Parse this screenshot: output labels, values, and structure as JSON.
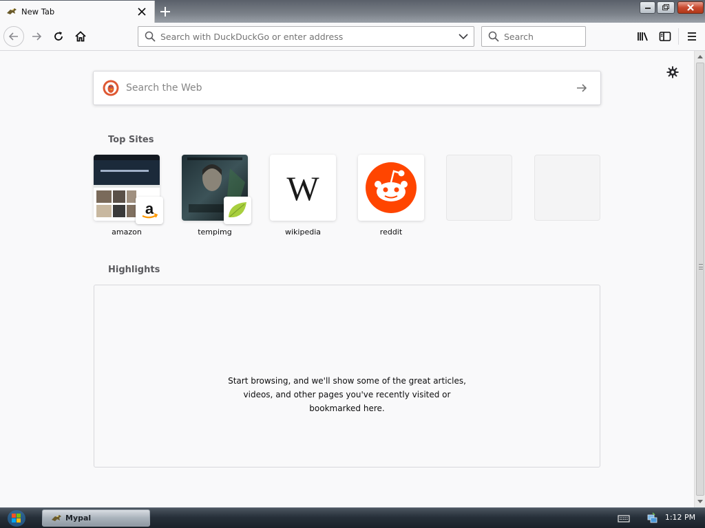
{
  "tab": {
    "title": "New Tab"
  },
  "navbar": {
    "url_placeholder": "Search with DuckDuckGo or enter address",
    "search_placeholder": "Search"
  },
  "newtab": {
    "websearch_placeholder": "Search the Web",
    "top_sites_title": "Top Sites",
    "highlights_title": "Highlights",
    "top_sites": [
      {
        "label": "amazon",
        "icon": "amazon-thumbnail"
      },
      {
        "label": "tempimg",
        "icon": "tempimg-thumbnail"
      },
      {
        "label": "wikipedia",
        "icon": "wikipedia-logo"
      },
      {
        "label": "reddit",
        "icon": "reddit-logo"
      },
      {
        "label": "",
        "icon": ""
      },
      {
        "label": "",
        "icon": ""
      }
    ],
    "highlights_line1": "Start browsing, and we'll show some of the great articles,",
    "highlights_line2": "videos, and other pages you've recently visited or",
    "highlights_line3": "bookmarked here."
  },
  "taskbar": {
    "app_label": "Mypal",
    "clock": "1:12 PM"
  },
  "colors": {
    "reddit": "#ff4500",
    "ddg": "#de5833"
  }
}
